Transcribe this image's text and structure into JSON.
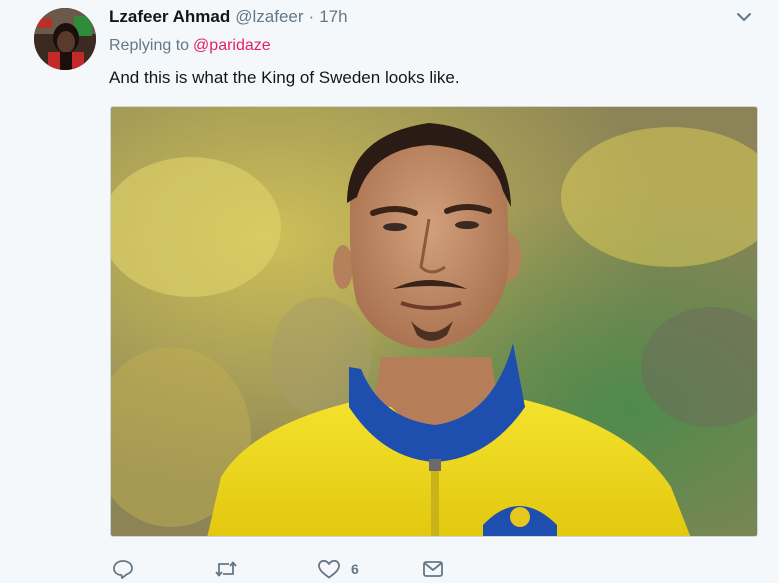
{
  "tweet": {
    "author_name": "Lzafeer Ahmad",
    "author_handle": "@lzafeer",
    "separator": "·",
    "time": "17h",
    "reply_prefix": "Replying to",
    "reply_to": "@paridaze",
    "text": "And this is what the King of Sweden looks like.",
    "media_alt": "Photo of a man in a yellow and blue Sweden football jersey",
    "likes_count": "6",
    "icons": {
      "reply": "reply-icon",
      "retweet": "retweet-icon",
      "like": "heart-icon",
      "dm": "envelope-icon",
      "menu": "chevron-down-icon"
    }
  },
  "colors": {
    "background": "#f5f8fa",
    "text_primary": "#14171a",
    "text_secondary": "#657786",
    "mention": "#e0245e",
    "jersey_yellow": "#f2dc1b",
    "jersey_blue": "#1f4fae"
  }
}
